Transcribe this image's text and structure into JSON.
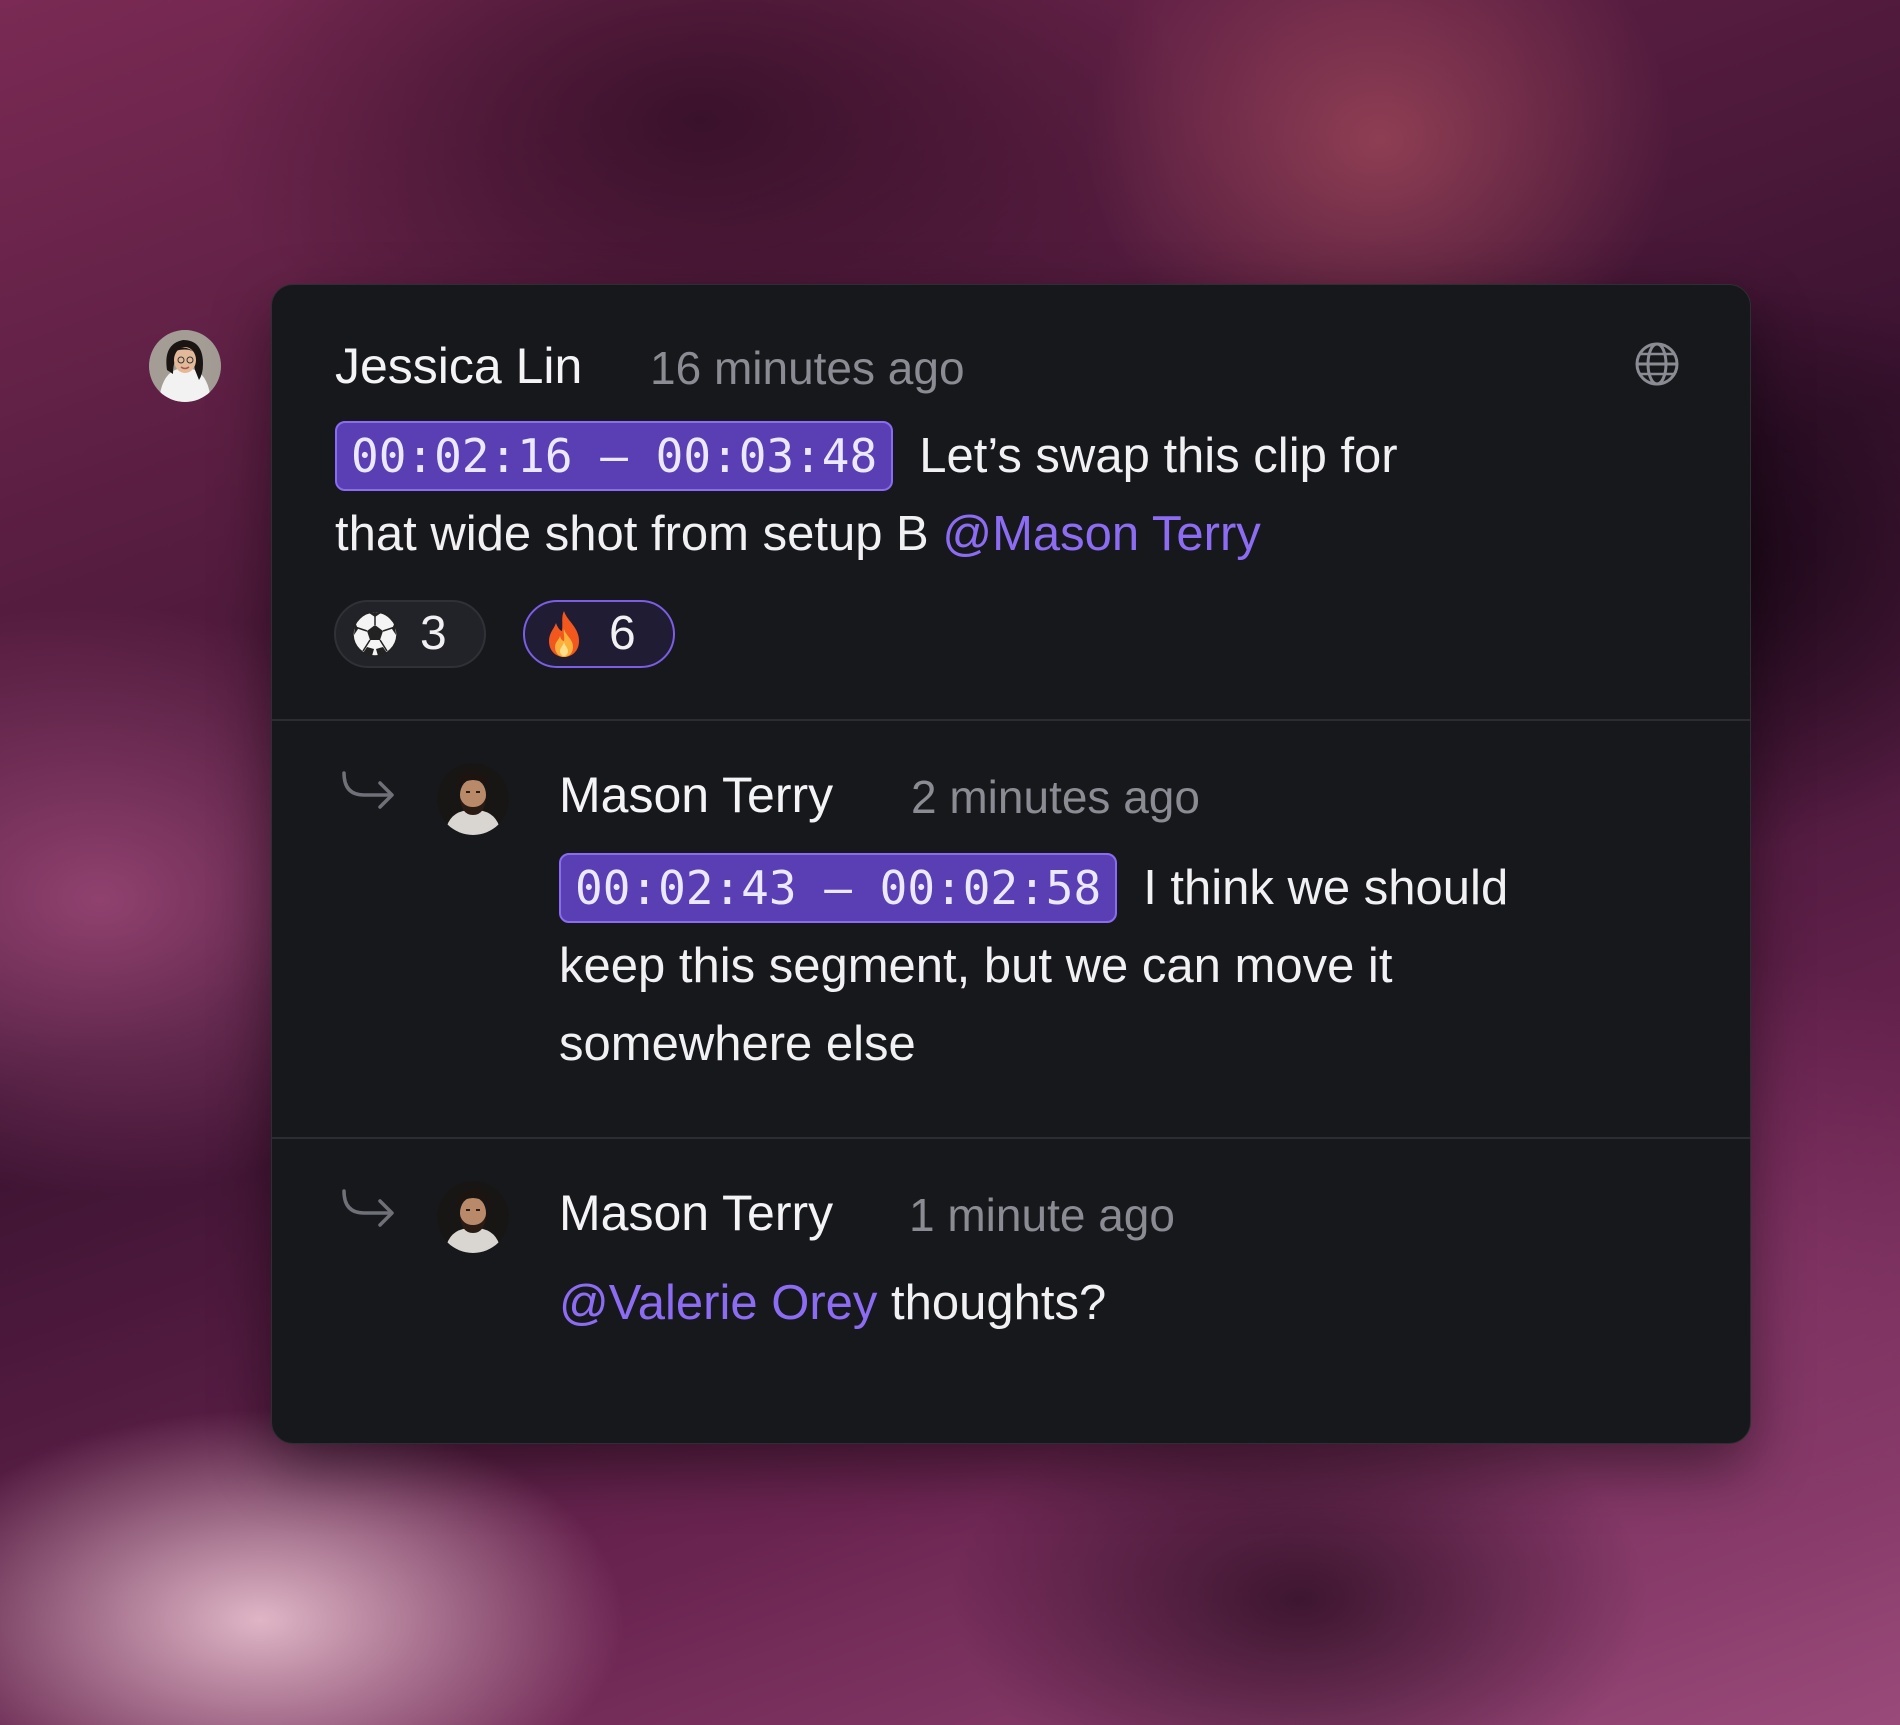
{
  "thread": {
    "root": {
      "author": "Jessica Lin",
      "time": "16 minutes ago",
      "timestamp_range": "00:02:16 – 00:03:48",
      "message_line1": "Let’s swap this clip for",
      "message_line2": "that wide shot from setup B ",
      "mention": "@Mason Terry",
      "visibility_icon": "globe-icon",
      "reactions": [
        {
          "emoji": "soccer-ball-emoji",
          "count": "3",
          "active": false
        },
        {
          "emoji": "fire-emoji",
          "count": "6",
          "active": true
        }
      ]
    },
    "replies": [
      {
        "author": "Mason Terry",
        "time": "2 minutes ago",
        "timestamp_range": "00:02:43 – 00:02:58",
        "message_line1": "I think we should",
        "message_line2": "keep this segment, but we can move it",
        "message_line3": "somewhere else"
      },
      {
        "author": "Mason Terry",
        "time": "1 minute ago",
        "mention": "@Valerie Orey",
        "message": " thoughts?"
      }
    ]
  },
  "colors": {
    "panel_background": "#17181c",
    "accent": "#8c6cf2",
    "timestamp_chip": "#5a3fb4",
    "muted_text": "#8a8b93"
  }
}
